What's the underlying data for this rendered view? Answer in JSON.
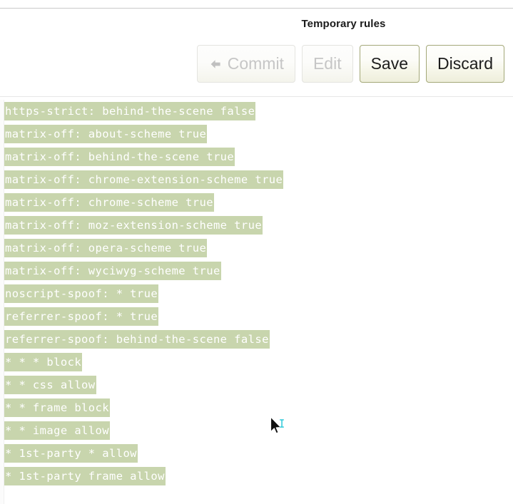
{
  "header": {
    "title": "Temporary rules",
    "buttons": [
      {
        "name": "commit",
        "label": "Commit",
        "icon": "arrow-left-icon",
        "state": "disabled"
      },
      {
        "name": "edit",
        "label": "Edit",
        "icon": null,
        "state": "disabled"
      },
      {
        "name": "save",
        "label": "Save",
        "icon": null,
        "state": "enabled"
      },
      {
        "name": "discard",
        "label": "Discard",
        "icon": null,
        "state": "enabled"
      }
    ]
  },
  "colors": {
    "rule_highlight": "#c8d5ad",
    "rule_text": "#ffffff",
    "divider": "#c9c9c9",
    "enabled_button_border": "#a3a878",
    "disabled_button_text": "#c6c6c6",
    "cursor_ibeam": "#2ec8d8"
  },
  "rules": [
    {
      "text": "https-strict: behind-the-scene false"
    },
    {
      "text": "matrix-off: about-scheme true"
    },
    {
      "text": "matrix-off: behind-the-scene true"
    },
    {
      "text": "matrix-off: chrome-extension-scheme true"
    },
    {
      "text": "matrix-off: chrome-scheme true"
    },
    {
      "text": "matrix-off: moz-extension-scheme true"
    },
    {
      "text": "matrix-off: opera-scheme true"
    },
    {
      "text": "matrix-off: wyciwyg-scheme true"
    },
    {
      "text": "noscript-spoof: * true"
    },
    {
      "text": "referrer-spoof: * true"
    },
    {
      "text": "referrer-spoof: behind-the-scene false"
    },
    {
      "text": "* * * block"
    },
    {
      "text": "* * css allow"
    },
    {
      "text": "* * frame block"
    },
    {
      "text": "* * image allow"
    },
    {
      "text": "* 1st-party * allow"
    },
    {
      "text": "* 1st-party frame allow"
    }
  ],
  "cursor": {
    "type": "text-select-cursor"
  }
}
